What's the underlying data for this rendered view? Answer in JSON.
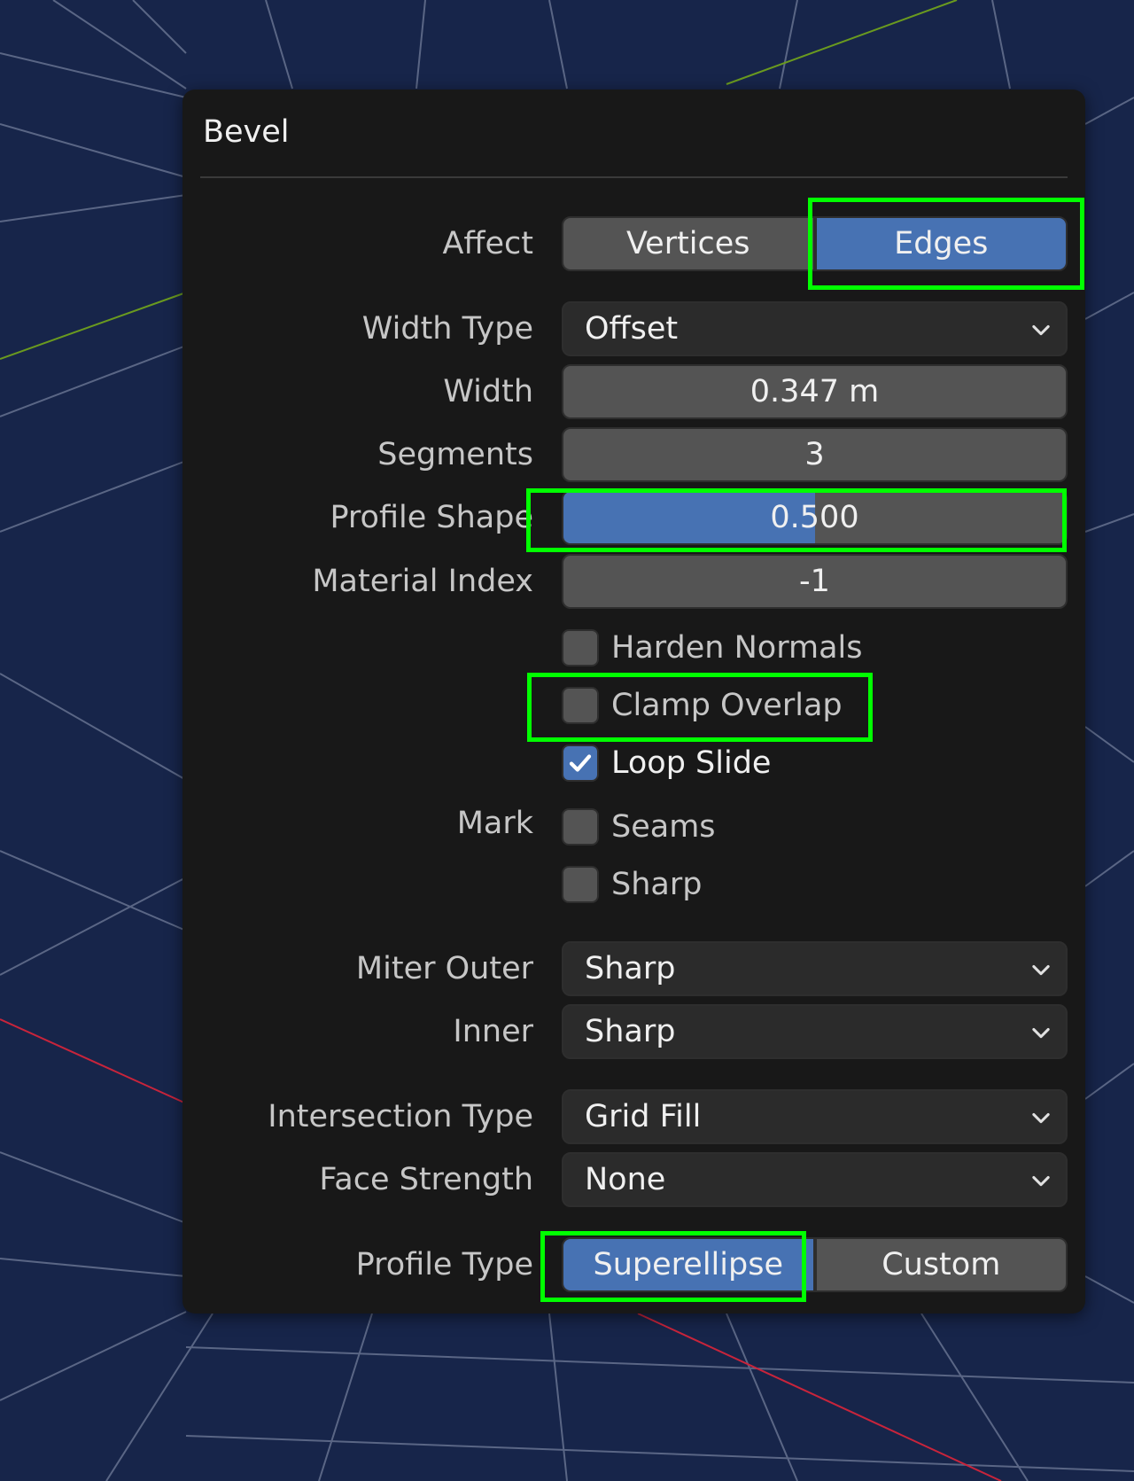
{
  "panel": {
    "title": "Bevel",
    "affect": {
      "label": "Affect",
      "options": [
        "Vertices",
        "Edges"
      ],
      "selected": "Edges"
    },
    "width_type": {
      "label": "Width Type",
      "value": "Offset"
    },
    "width": {
      "label": "Width",
      "value": "0.347 m"
    },
    "segments": {
      "label": "Segments",
      "value": "3"
    },
    "profile_shape": {
      "label": "Profile Shape",
      "value": "0.500",
      "fraction": 0.5
    },
    "material_index": {
      "label": "Material Index",
      "value": "-1"
    },
    "harden_normals": {
      "label": "Harden Normals",
      "checked": false
    },
    "clamp_overlap": {
      "label": "Clamp Overlap",
      "checked": false
    },
    "loop_slide": {
      "label": "Loop Slide",
      "checked": true
    },
    "mark": {
      "label": "Mark",
      "seams": {
        "label": "Seams",
        "checked": false
      },
      "sharp": {
        "label": "Sharp",
        "checked": false
      }
    },
    "miter_outer": {
      "label": "Miter Outer",
      "value": "Sharp"
    },
    "miter_inner": {
      "label": "Inner",
      "value": "Sharp"
    },
    "intersection_type": {
      "label": "Intersection Type",
      "value": "Grid Fill"
    },
    "face_strength": {
      "label": "Face Strength",
      "value": "None"
    },
    "profile_type": {
      "label": "Profile Type",
      "options": [
        "Superellipse",
        "Custom"
      ],
      "selected": "Superellipse"
    }
  },
  "colors": {
    "viewport_bg": "#17254a",
    "panel_bg": "#181818",
    "field_bg": "#545454",
    "dropdown_bg": "#2b2b2b",
    "accent": "#4772b3",
    "highlight": "#00ff00",
    "grid_line": "#5a6685",
    "x_axis": "#c8243b",
    "y_axis": "#6a9a1f"
  },
  "icons": {
    "dropdown": "chevron-down-icon",
    "check": "checkmark-icon"
  }
}
